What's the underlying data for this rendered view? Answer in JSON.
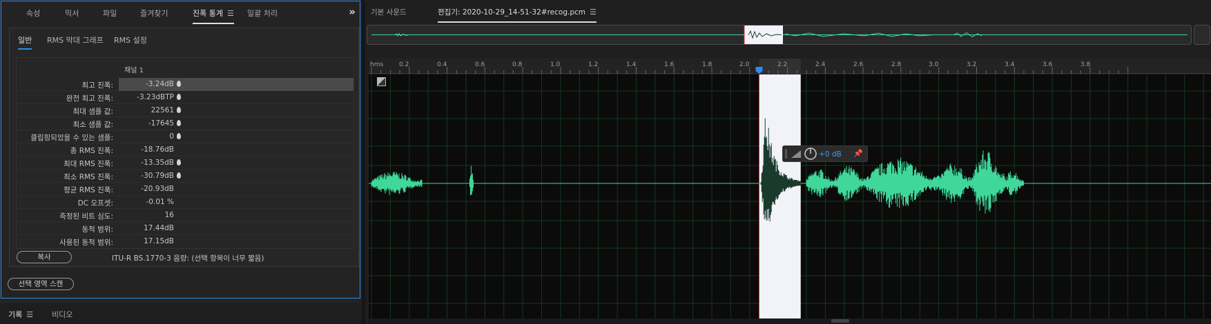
{
  "left_panel": {
    "tabs": [
      {
        "label": "속성"
      },
      {
        "label": "믹서"
      },
      {
        "label": "파일"
      },
      {
        "label": "즐겨찾기"
      },
      {
        "label": "진폭 통계"
      },
      {
        "label": "일괄 처리"
      }
    ],
    "active_tab": "진폭 통계",
    "subtabs": [
      {
        "label": "일반"
      },
      {
        "label": "RMS 막대 그래프"
      },
      {
        "label": "RMS 설정"
      }
    ],
    "channel_header": "채널 1",
    "rows": [
      {
        "label": "최고 진폭:",
        "value": "-3.24dB"
      },
      {
        "label": "완전 최고 진폭:",
        "value": "-3.23dBTP"
      },
      {
        "label": "최대 샘플 값:",
        "value": "22561"
      },
      {
        "label": "최소 샘플 값:",
        "value": "-17645"
      },
      {
        "label": "클립핑되었을 수 있는 샘플:",
        "value": "0"
      },
      {
        "label": "총 RMS 진폭:",
        "value": "-18.76dB"
      },
      {
        "label": "최대 RMS 진폭:",
        "value": "-13.35dB"
      },
      {
        "label": "최소 RMS 진폭:",
        "value": "-30.79dB"
      },
      {
        "label": "평균 RMS 진폭:",
        "value": "-20.93dB"
      },
      {
        "label": "DC 오프셋:",
        "value": "-0.01 %"
      },
      {
        "label": "측정된 비트 심도:",
        "value": "16"
      },
      {
        "label": "동적 범위:",
        "value": "17.44dB"
      },
      {
        "label": "사용된 동적 범위:",
        "value": "17.15dB"
      }
    ],
    "copy_button": "복사",
    "itu_text": "ITU-R BS.1770-3 음량: (선택 항목이 너무 짧음)",
    "scan_button": "선택 영역 스캔",
    "bottom_tabs": [
      {
        "label": "기록"
      },
      {
        "label": "비디오"
      }
    ]
  },
  "editor": {
    "tabs": [
      {
        "label": "기본 사운드"
      },
      {
        "label": "편집기: 2020-10-29_14-51-32#recog.pcm"
      }
    ],
    "ruler": {
      "unit_label": "hms",
      "ticks": [
        "0.2",
        "0.4",
        "0.6",
        "0.8",
        "1.0",
        "1.2",
        "1.4",
        "1.6",
        "1.8",
        "2.0",
        "2.2",
        "2.4",
        "2.6",
        "2.8",
        "3.0",
        "3.2",
        "3.4",
        "3.6",
        "3.8"
      ]
    },
    "hud_gain": "+0 dB",
    "waveform_color": "#3fd79a",
    "selection_color": "#f2f3f8"
  }
}
